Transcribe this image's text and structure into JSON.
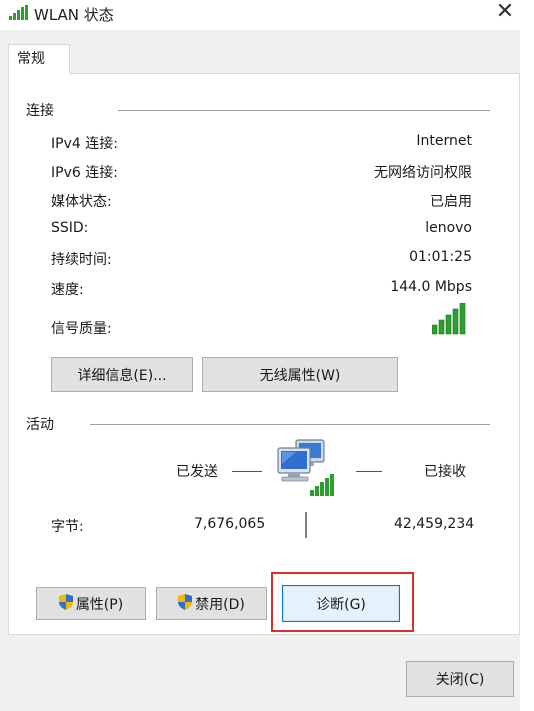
{
  "window": {
    "title": "WLAN 状态",
    "close_glyph": "✕"
  },
  "tabs": [
    {
      "label": "常规"
    }
  ],
  "connection": {
    "section_label": "连接",
    "rows": [
      {
        "label": "IPv4 连接:",
        "value": "Internet"
      },
      {
        "label": "IPv6 连接:",
        "value": "无网络访问权限"
      },
      {
        "label": "媒体状态:",
        "value": "已启用"
      },
      {
        "label": "SSID:",
        "value": "lenovo"
      },
      {
        "label": "持续时间:",
        "value": "01:01:25"
      },
      {
        "label": "速度:",
        "value": "144.0 Mbps"
      }
    ],
    "signal_label": "信号质量:",
    "signal_icon": "signal-bars-icon",
    "details_button": "详细信息(E)...",
    "wireless_props_button": "无线属性(W)"
  },
  "activity": {
    "section_label": "活动",
    "sent_label": "已发送",
    "received_label": "已接收",
    "network_icon": "network-computers-icon",
    "bytes_label": "字节:",
    "bytes_sent": "7,676,065",
    "bytes_received": "42,459,234"
  },
  "buttons": {
    "properties": "属性(P)",
    "disable": "禁用(D)",
    "diagnose": "诊断(G)",
    "close": "关闭(C)"
  },
  "colors": {
    "signal_green": "#2e9e2e",
    "highlight_red": "#d9302c",
    "focus_blue": "#0078d7"
  }
}
